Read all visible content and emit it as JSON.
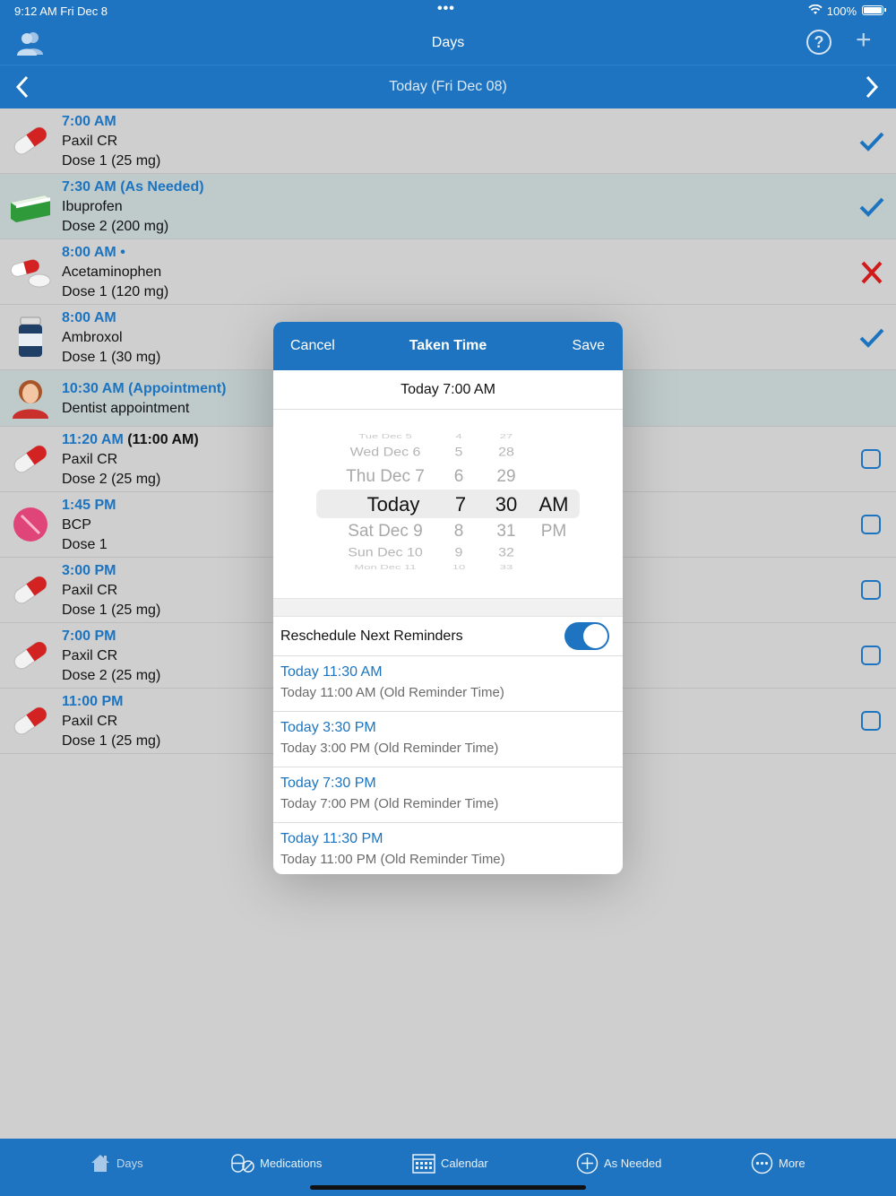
{
  "status_bar": {
    "time": "9:12 AM   Fri Dec 8",
    "battery": "100%"
  },
  "nav": {
    "title": "Days"
  },
  "date_bar": {
    "date": "Today (Fri Dec 08)"
  },
  "rows": [
    {
      "time": "7:00 AM",
      "extra": "",
      "name": "Paxil CR",
      "dose": "Dose 1 (25 mg)",
      "status": "check"
    },
    {
      "time": "7:30 AM (As Needed)",
      "extra": "",
      "name": "Ibuprofen",
      "dose": "Dose 2 (200 mg)",
      "status": "check"
    },
    {
      "time": "8:00 AM •",
      "extra": "",
      "name": "Acetaminophen",
      "dose": "Dose 1 (120 mg)",
      "status": "missed"
    },
    {
      "time": "8:00 AM",
      "extra": "",
      "name": "Ambroxol",
      "dose": "Dose 1 (30 mg)",
      "status": "check"
    },
    {
      "time": "10:30 AM (Appointment)",
      "extra": "",
      "name": "Dentist appointment",
      "dose": "",
      "status": "none"
    },
    {
      "time": "11:20 AM",
      "extra": " (11:00 AM)",
      "name": "Paxil CR",
      "dose": "Dose 2 (25 mg)",
      "status": "empty"
    },
    {
      "time": "1:45 PM",
      "extra": "",
      "name": "BCP",
      "dose": "Dose 1",
      "status": "empty"
    },
    {
      "time": "3:00 PM",
      "extra": "",
      "name": "Paxil CR",
      "dose": "Dose 1 (25 mg)",
      "status": "empty"
    },
    {
      "time": "7:00 PM",
      "extra": "",
      "name": "Paxil CR",
      "dose": "Dose 2 (25 mg)",
      "status": "empty"
    },
    {
      "time": "11:00 PM",
      "extra": "",
      "name": "Paxil CR",
      "dose": "Dose 1 (25 mg)",
      "status": "empty"
    }
  ],
  "modal": {
    "cancel": "Cancel",
    "title": "Taken Time",
    "save": "Save",
    "selected": "Today 7:00 AM",
    "picker": {
      "days": [
        "Tue Dec 5",
        "Wed Dec 6",
        "Thu Dec 7",
        "Today",
        "Sat Dec 9",
        "Sun Dec 10",
        "Mon Dec 11"
      ],
      "hours": [
        "4",
        "5",
        "6",
        "7",
        "8",
        "9",
        "10"
      ],
      "minutes": [
        "27",
        "28",
        "29",
        "30",
        "31",
        "32",
        "33"
      ],
      "ampm": [
        "AM",
        "PM"
      ]
    },
    "toggle_label": "Reschedule Next Reminders",
    "toggle_on": true,
    "reminders": [
      {
        "new": "Today 11:30 AM",
        "old": "Today 11:00 AM (Old Reminder Time)"
      },
      {
        "new": "Today 3:30 PM",
        "old": "Today 3:00 PM (Old Reminder Time)"
      },
      {
        "new": "Today 7:30 PM",
        "old": "Today 7:00 PM (Old Reminder Time)"
      },
      {
        "new": "Today 11:30 PM",
        "old": "Today 11:00 PM (Old Reminder Time)"
      }
    ]
  },
  "tabs": [
    {
      "label": "Days",
      "icon": "house-icon"
    },
    {
      "label": "Medications",
      "icon": "pills-icon"
    },
    {
      "label": "Calendar",
      "icon": "calendar-icon"
    },
    {
      "label": "As Needed",
      "icon": "plus-circle-icon"
    },
    {
      "label": "More",
      "icon": "ellipsis-circle-icon"
    }
  ],
  "colors": {
    "accent": "#1e74c0",
    "missed": "#d11a1a"
  }
}
